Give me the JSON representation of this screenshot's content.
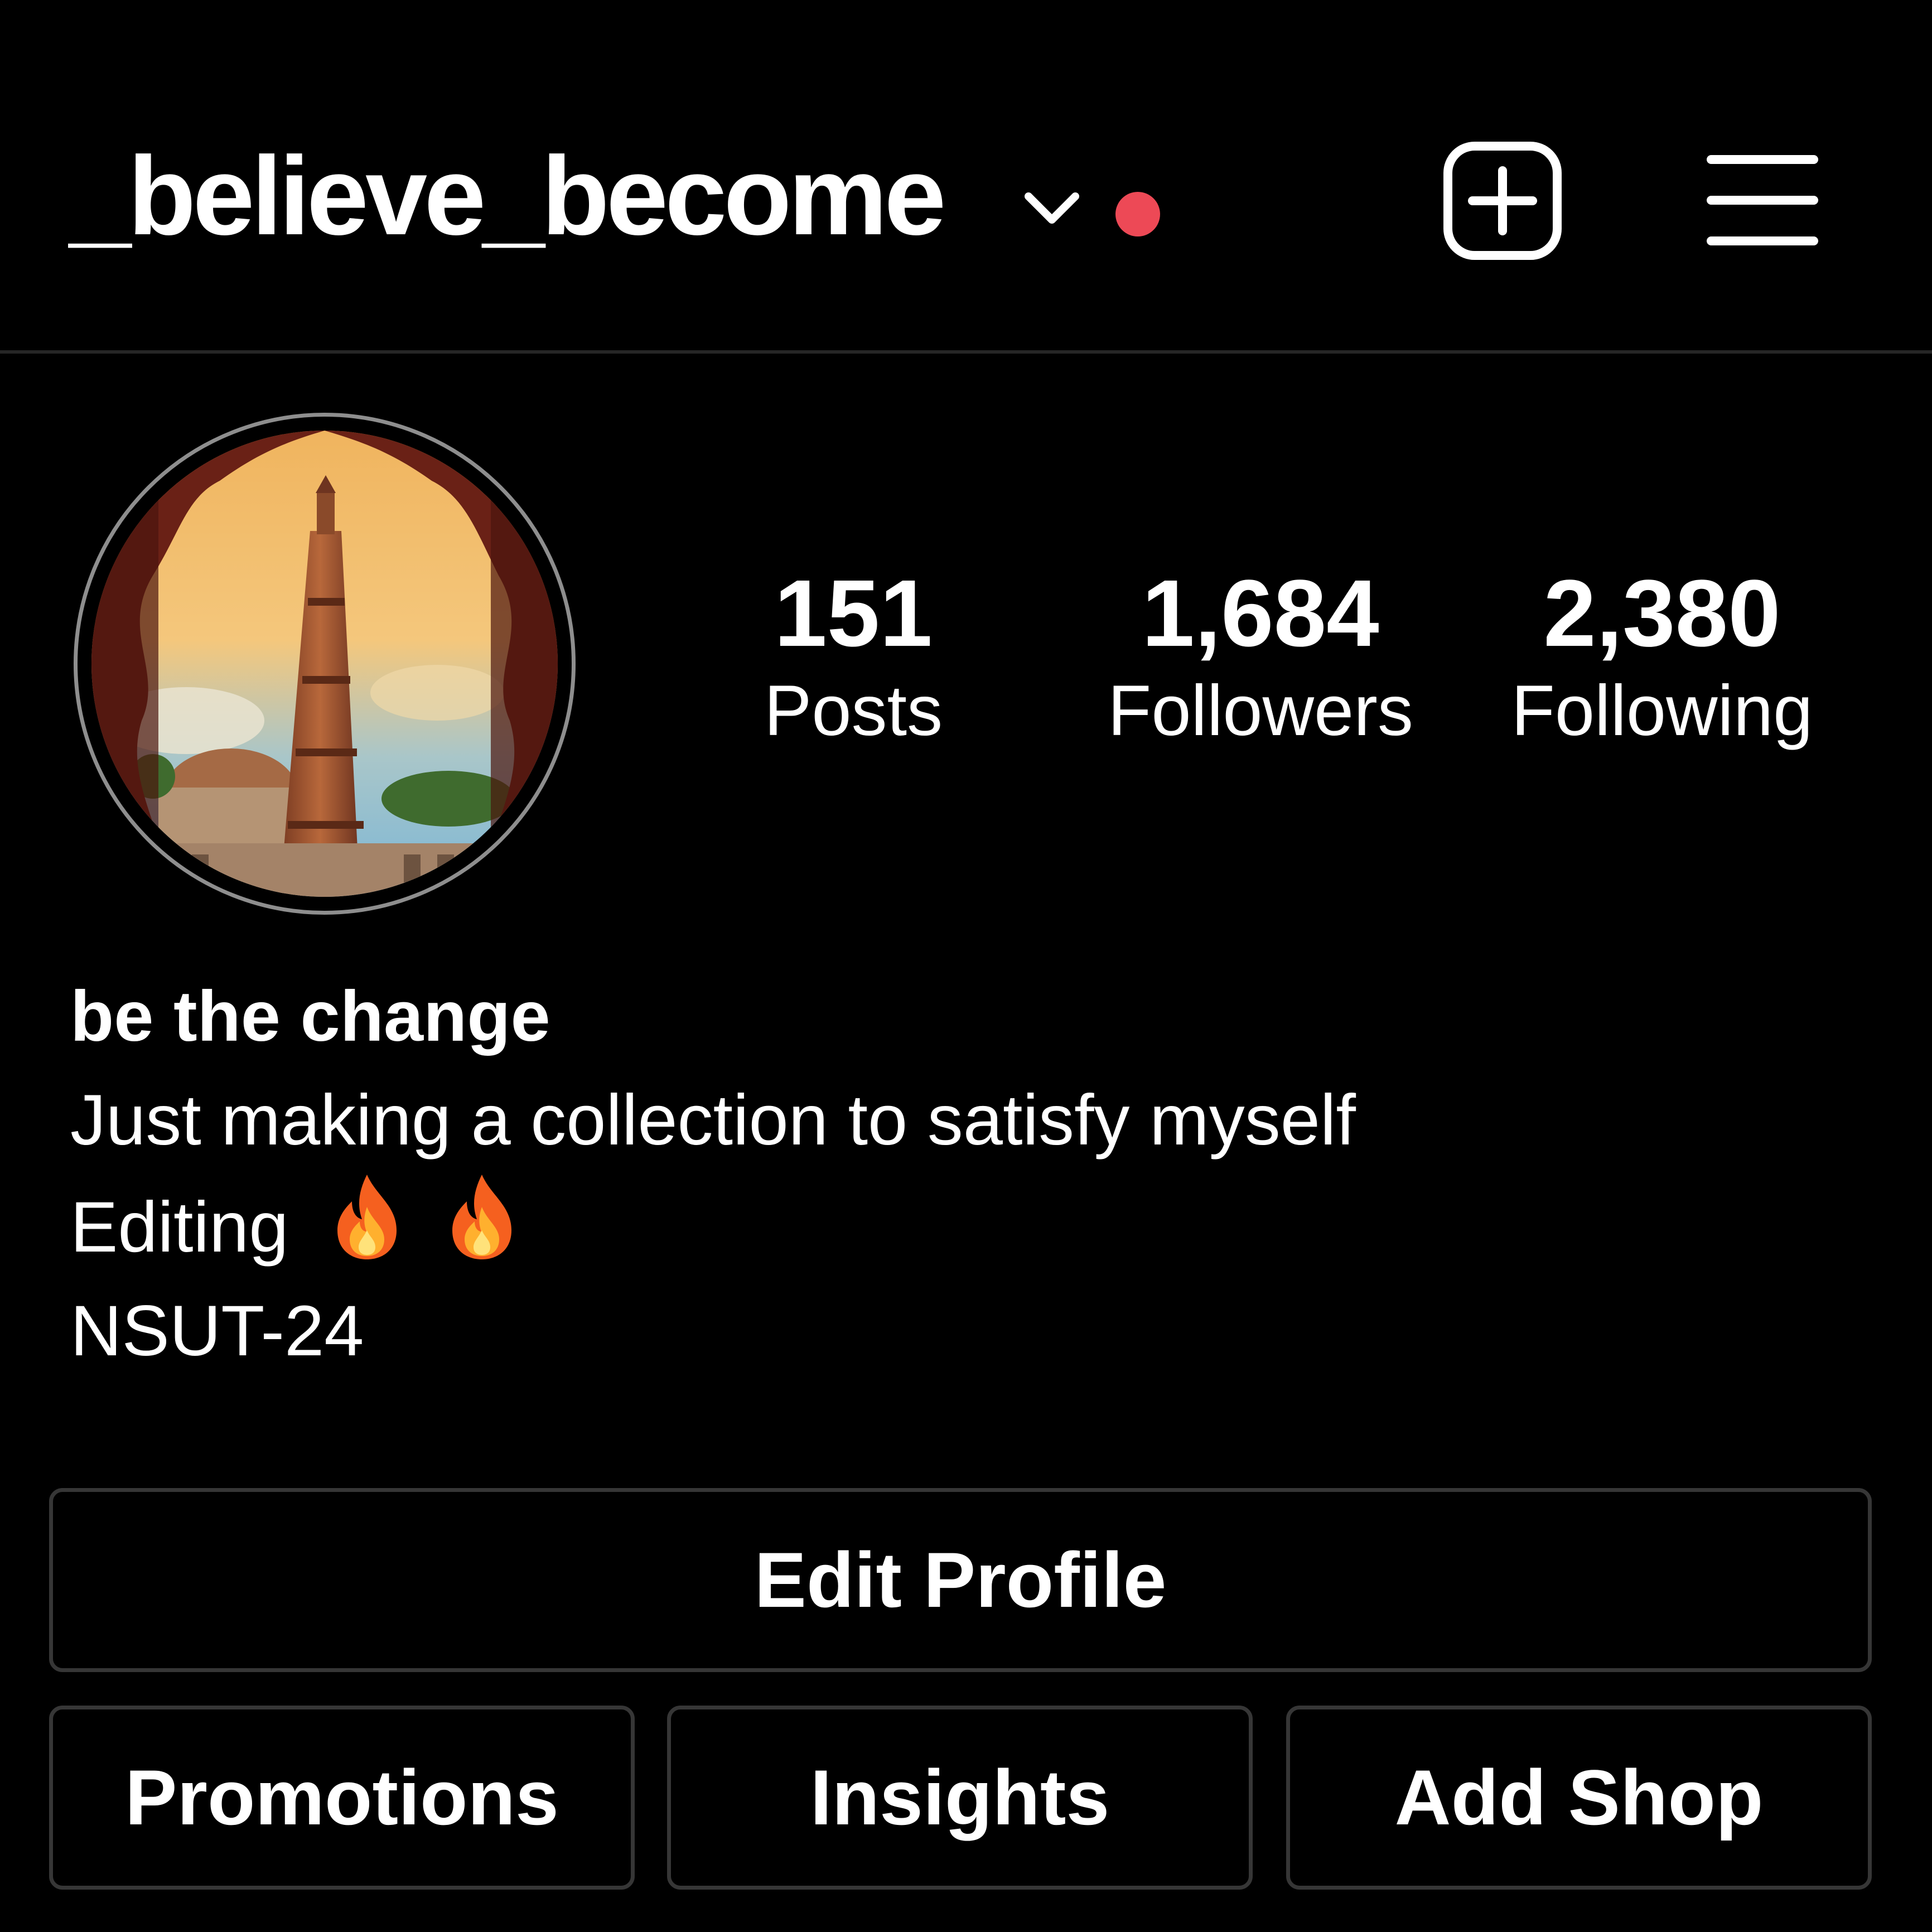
{
  "header": {
    "username": "_believe_become",
    "notification_dot_color": "#ed4956",
    "icons": [
      "chevron-down-icon",
      "new-post-icon",
      "menu-icon"
    ]
  },
  "profile": {
    "avatar": "qutub-minar-photo",
    "stats": {
      "posts": {
        "value": "151",
        "label": "Posts"
      },
      "followers": {
        "value": "1,684",
        "label": "Followers"
      },
      "following": {
        "value": "2,380",
        "label": "Following"
      }
    }
  },
  "bio": {
    "name": "be the change",
    "line1": "Just making a collection to satisfy myself",
    "line2": "Editing",
    "line2_emoji": [
      "fire-emoji",
      "fire-emoji"
    ],
    "line3": "NSUT-24"
  },
  "buttons": {
    "edit_profile": "Edit Profile",
    "promotions": "Promotions",
    "insights": "Insights",
    "add_shop": "Add Shop"
  },
  "colors": {
    "background": "#000000",
    "text": "#ffffff",
    "button_border": "#363636",
    "accent_dot": "#ed4956"
  }
}
